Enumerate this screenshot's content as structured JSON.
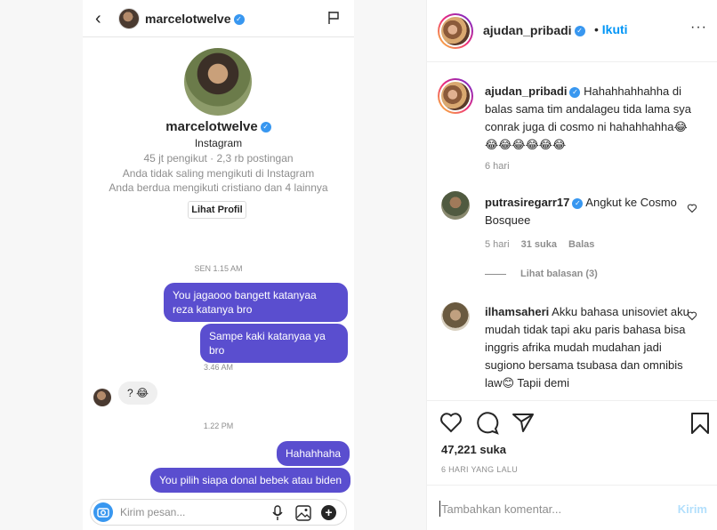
{
  "dm": {
    "back_glyph": "‹",
    "username": "marcelotwelve",
    "verified_glyph": "✓",
    "profile": {
      "name": "marcelotwelve",
      "platform": "Instagram",
      "stats": "45 jt pengikut · 2,3 rb postingan",
      "follow_note": "Anda tidak saling mengikuti di Instagram",
      "mutual_note": "Anda berdua mengikuti cristiano dan 4 lainnya",
      "view_profile_label": "Lihat Profil"
    },
    "timestamps": [
      "SEN 1.15 AM",
      "3.46 AM",
      "1.22 PM"
    ],
    "messages": [
      {
        "text": "You jagaooo bangett katanyaa reza katanya bro"
      },
      {
        "text": "Sampe kaki katanyaa ya bro"
      },
      {
        "text": "? 😂"
      },
      {
        "text": "Hahahhaha"
      },
      {
        "text": "You pilih siapa donal bebek atau biden"
      }
    ],
    "composer_placeholder": "Kirim pesan..."
  },
  "post": {
    "header": {
      "username": "ajudan_pribadi",
      "follow_label": "Ikuti",
      "dot": "•",
      "more_glyph": "···"
    },
    "caption": {
      "username": "ajudan_pribadi",
      "text": "Hahahhahhahha di balas sama tim andalageu tida lama sya conrak juga di cosmo ni hahahhahha😂😂😂😂😂😂😂",
      "time": "6 hari"
    },
    "comments": [
      {
        "username": "putrasiregarr17",
        "text": "Angkut ke Cosmo Bosquee",
        "time": "5 hari",
        "likes": "31 suka",
        "reply_label": "Balas",
        "view_replies": "Lihat balasan (3)"
      },
      {
        "username": "ilhamsaheri",
        "text": "Akku bahasa unisoviet aku mudah tidak tapi aku paris bahasa bisa inggris afrika mudah mudahan jadi sugiono bersama tsubasa dan omnibis law😊 Tapii demi"
      }
    ],
    "likes": "47,221 suka",
    "posted": "6 HARI YANG LALU",
    "comment_placeholder": "Tambahkan komentar...",
    "post_label": "Kirim"
  }
}
